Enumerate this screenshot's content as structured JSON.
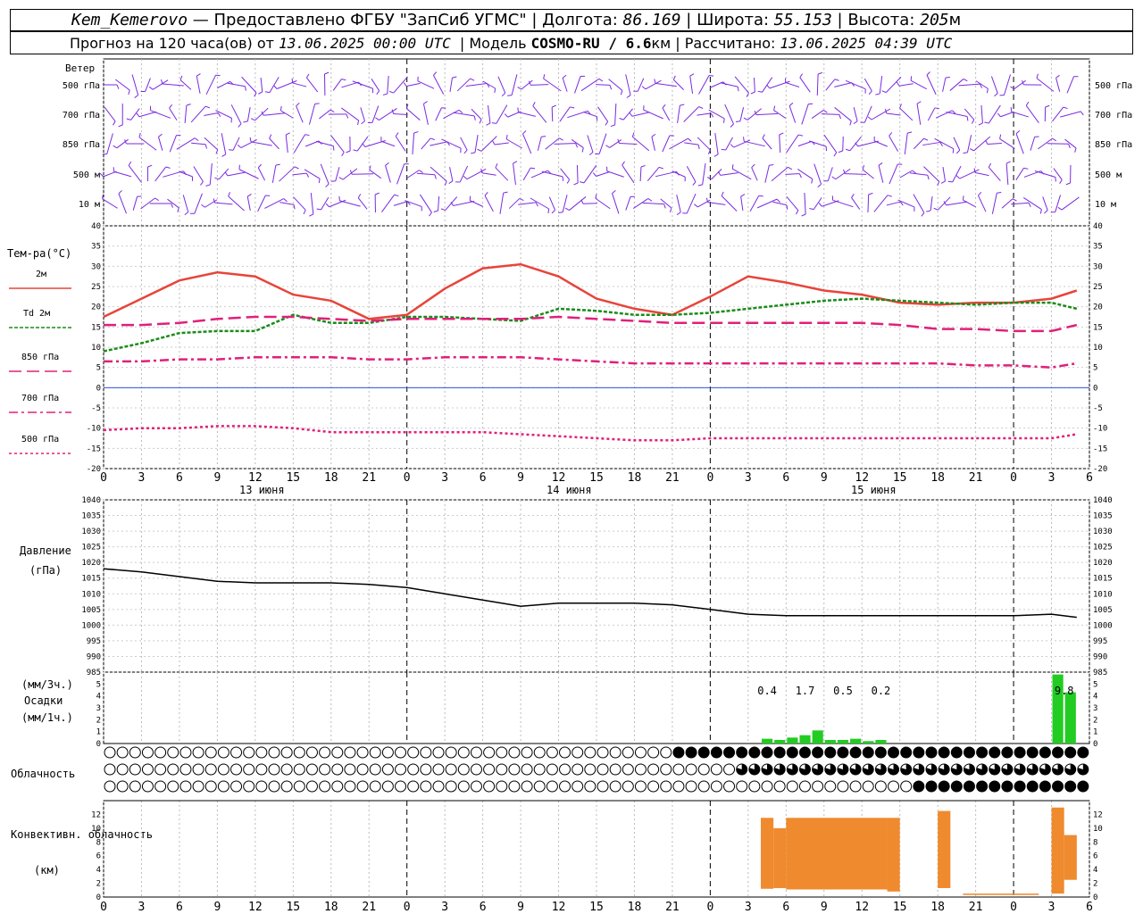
{
  "header": {
    "station": "Kem_Kemerovo",
    "provider": "Предоставлено ФГБУ \"ЗапСиб УГМС\"",
    "lon_label": "Долгота:",
    "lon": "86.169",
    "lat_label": "Широта:",
    "lat": "55.153",
    "alt_label": "Высота:",
    "alt": "205",
    "alt_unit": "м",
    "forecast_label": "Прогноз на 120 часа(ов) от",
    "forecast_from": "13.06.2025 00:00 UTC",
    "model_label": "Модель",
    "model": "COSMO-RU / 6.6",
    "model_unit": "км",
    "calc_label": "Рассчитано:",
    "calc_time": "13.06.2025 04:39 UTC"
  },
  "wind_panel": {
    "title": "Ветер",
    "levels": [
      "500 гПа",
      "700 гПа",
      "850 гПа",
      "500 м",
      "10  м"
    ]
  },
  "colors": {
    "t2m": "#e8443a",
    "td2m": "#1a8c1a",
    "t850": "#e0207a",
    "t700": "#e0207a",
    "t500": "#e0207a",
    "zero": "#3050e0",
    "wind": "#7a2ae0",
    "precip": "#22cc22",
    "conv": "#ef8a2e",
    "pressure": "#000000"
  },
  "time_axis": {
    "hour_labels": [
      "0",
      "3",
      "6",
      "9",
      "12",
      "15",
      "18",
      "21",
      "0",
      "3",
      "6",
      "9",
      "12",
      "15",
      "18",
      "21",
      "0",
      "3",
      "6",
      "9",
      "12",
      "15",
      "18",
      "21",
      "0",
      "3",
      "6"
    ],
    "day_labels": [
      "13 июня",
      "14 июня",
      "15 июня"
    ]
  },
  "chart_data": [
    {
      "type": "line",
      "title": "Тем-ра(°C)",
      "ylim": [
        -20,
        40
      ],
      "ytick_labels": [
        "40",
        "35",
        "30",
        "25",
        "20",
        "15",
        "10",
        "5",
        "0",
        "-5",
        "-10",
        "-15",
        "-20"
      ],
      "x_hours": [
        0,
        3,
        6,
        9,
        12,
        15,
        18,
        21,
        24,
        27,
        30,
        33,
        36,
        39,
        42,
        45,
        48,
        51,
        54,
        57,
        60,
        63,
        66,
        69,
        72,
        75,
        77
      ],
      "series": [
        {
          "name": "2м",
          "values": [
            17.5,
            22,
            26.5,
            28.5,
            27.5,
            23,
            21.5,
            17,
            18,
            24.5,
            29.5,
            30.5,
            27.5,
            22,
            19.5,
            18,
            22.5,
            27.5,
            26,
            24,
            23,
            21,
            20.5,
            21,
            21,
            22,
            24
          ]
        },
        {
          "name": "Td  2м",
          "values": [
            9,
            11,
            13.5,
            14,
            14,
            18,
            16,
            16,
            17.5,
            17.5,
            17,
            16.5,
            19.5,
            19,
            18,
            18,
            18.5,
            19.5,
            20.5,
            21.5,
            22,
            21.5,
            21,
            20.5,
            21,
            21,
            19.5
          ]
        },
        {
          "name": "850 гПа",
          "values": [
            15.5,
            15.5,
            16,
            17,
            17.5,
            17.5,
            17,
            16.5,
            17,
            17,
            17,
            17,
            17.5,
            17,
            16.5,
            16,
            16,
            16,
            16,
            16,
            16,
            15.5,
            14.5,
            14.5,
            14,
            14,
            15.5
          ]
        },
        {
          "name": "700 гПа",
          "values": [
            6.5,
            6.5,
            7,
            7,
            7.5,
            7.5,
            7.5,
            7,
            7,
            7.5,
            7.5,
            7.5,
            7,
            6.5,
            6,
            6,
            6,
            6,
            6,
            6,
            6,
            6,
            6,
            5.5,
            5.5,
            5,
            6
          ]
        },
        {
          "name": "500 гПа",
          "values": [
            -10.5,
            -10,
            -10,
            -9.5,
            -9.5,
            -10,
            -11,
            -11,
            -11,
            -11,
            -11,
            -11.5,
            -12,
            -12.5,
            -13,
            -13,
            -12.5,
            -12.5,
            -12.5,
            -12.5,
            -12.5,
            -12.5,
            -12.5,
            -12.5,
            -12.5,
            -12.5,
            -11.5
          ]
        }
      ]
    },
    {
      "type": "line",
      "title": "Давление",
      "unit": "(гПа)",
      "ylim": [
        985,
        1040
      ],
      "ytick_labels": [
        "1040",
        "1035",
        "1030",
        "1025",
        "1020",
        "1015",
        "1010",
        "1005",
        "1000",
        "995",
        "990",
        "985"
      ],
      "x_hours": [
        0,
        3,
        6,
        9,
        12,
        15,
        18,
        21,
        24,
        27,
        30,
        33,
        36,
        39,
        42,
        45,
        48,
        51,
        54,
        57,
        60,
        63,
        66,
        69,
        72,
        75,
        77
      ],
      "series": [
        {
          "name": "Давление",
          "values": [
            1018,
            1017,
            1015.5,
            1014,
            1013.5,
            1013.5,
            1013.5,
            1013,
            1012,
            1010,
            1008,
            1006,
            1007,
            1007,
            1007,
            1006.5,
            1005,
            1003.5,
            1003,
            1003,
            1003,
            1003,
            1003,
            1003,
            1003,
            1003.5,
            1002.5
          ]
        }
      ]
    },
    {
      "type": "bar",
      "title": "Осадки",
      "unit_3h": "(мм/3ч.)",
      "unit_1h": "(мм/1ч.)",
      "ylim": [
        0,
        6
      ],
      "ytick_labels": [
        "5",
        "4",
        "3",
        "2",
        "1",
        "0"
      ],
      "x_hours": [
        52,
        53,
        54,
        55,
        56,
        57,
        58,
        59,
        60,
        61,
        62,
        75,
        76
      ],
      "values": [
        0.4,
        0.3,
        0.5,
        0.7,
        1.1,
        0.3,
        0.3,
        0.4,
        0.2,
        0.3,
        0,
        5.8,
        4.3
      ],
      "labels_3h": [
        {
          "hour": 52.5,
          "text": "0.4"
        },
        {
          "hour": 55.5,
          "text": "1.7"
        },
        {
          "hour": 58.5,
          "text": "0.5"
        },
        {
          "hour": 61.5,
          "text": "0.2"
        },
        {
          "hour": 76,
          "text": "9.8"
        }
      ]
    },
    {
      "type": "bar",
      "title": "Облачность",
      "rows": 3,
      "note": "cloud-cover symbols per hour; fractions 0..1",
      "cover": [
        "0000000000000000000000050000000000400500000000000000000000000000000000000000",
        "0000000000000000000000000000000000000000000000000000000000000000000000000000",
        "0000000000000000000000000000000000000000000000000000000000000000000000000000"
      ],
      "cover_by_range": [
        {
          "row": 0,
          "from": 45,
          "to": 77,
          "value": 1
        },
        {
          "row": 1,
          "from": 50,
          "to": 77,
          "value": 0.8
        },
        {
          "row": 2,
          "from": 64,
          "to": 77,
          "value": 1
        }
      ]
    },
    {
      "type": "bar",
      "title": "Конвективн. облачность",
      "unit": "(км)",
      "ylim": [
        0,
        14
      ],
      "ytick_labels": [
        "12",
        "10",
        "8",
        "6",
        "4",
        "2",
        "0"
      ],
      "floating_bars": [
        {
          "from_hour": 52,
          "to_hour": 53,
          "bottom": 1.2,
          "top": 11.5
        },
        {
          "from_hour": 53,
          "to_hour": 54,
          "bottom": 1.3,
          "top": 10
        },
        {
          "from_hour": 54,
          "to_hour": 62,
          "bottom": 1.1,
          "top": 11.5
        },
        {
          "from_hour": 62,
          "to_hour": 63,
          "bottom": 0.8,
          "top": 11.5
        },
        {
          "from_hour": 66,
          "to_hour": 67,
          "bottom": 1.3,
          "top": 12.5
        },
        {
          "from_hour": 68,
          "to_hour": 74,
          "bottom": 0.3,
          "top": 0.5
        },
        {
          "from_hour": 75,
          "to_hour": 76,
          "bottom": 0.5,
          "top": 13
        },
        {
          "from_hour": 76,
          "to_hour": 77,
          "bottom": 2.5,
          "top": 9
        }
      ]
    }
  ]
}
